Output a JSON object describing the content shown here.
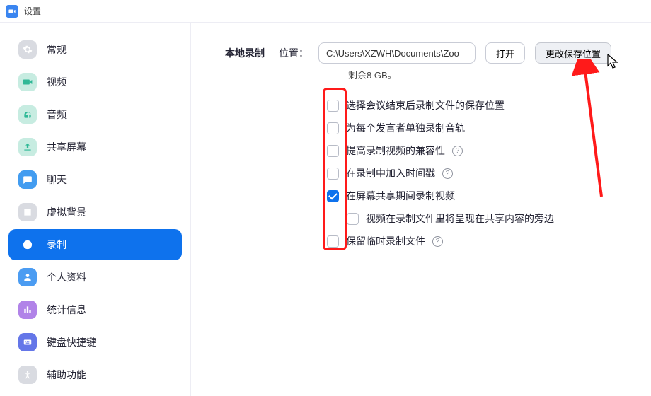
{
  "window": {
    "title": "设置"
  },
  "sidebar": {
    "items": [
      {
        "label": "常规"
      },
      {
        "label": "视频"
      },
      {
        "label": "音频"
      },
      {
        "label": "共享屏幕"
      },
      {
        "label": "聊天"
      },
      {
        "label": "虚拟背景"
      },
      {
        "label": "录制"
      },
      {
        "label": "个人资料"
      },
      {
        "label": "统计信息"
      },
      {
        "label": "键盘快捷键"
      },
      {
        "label": "辅助功能"
      }
    ],
    "active_index": 6
  },
  "main": {
    "section_title": "本地录制",
    "location_label": "位置：",
    "path": "C:\\Users\\XZWH\\Documents\\Zoo",
    "open_label": "打开",
    "change_location_label": "更改保存位置",
    "remaining_text": "剩余8 GB。",
    "options": [
      {
        "label": "选择会议结束后录制文件的保存位置",
        "checked": false,
        "help": false,
        "sub": false
      },
      {
        "label": "为每个发言者单独录制音轨",
        "checked": false,
        "help": false,
        "sub": false
      },
      {
        "label": "提高录制视频的兼容性",
        "checked": false,
        "help": true,
        "sub": false
      },
      {
        "label": "在录制中加入时间戳",
        "checked": false,
        "help": true,
        "sub": false
      },
      {
        "label": "在屏幕共享期间录制视频",
        "checked": true,
        "help": false,
        "sub": false
      },
      {
        "label": "视频在录制文件里将呈现在共享内容的旁边",
        "checked": false,
        "help": false,
        "sub": true
      },
      {
        "label": "保留临时录制文件",
        "checked": false,
        "help": true,
        "sub": false
      }
    ]
  }
}
